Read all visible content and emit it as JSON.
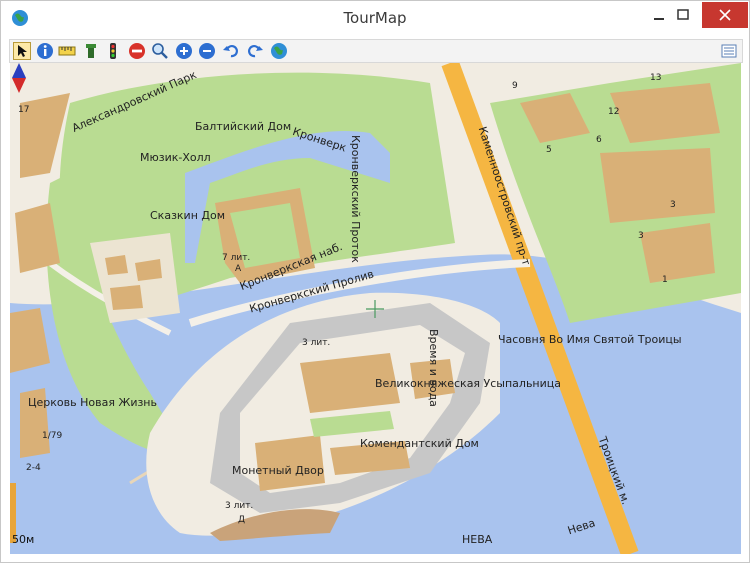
{
  "window": {
    "title": "TourMap"
  },
  "toolbar": {
    "tools": [
      {
        "name": "pointer-icon"
      },
      {
        "name": "info-icon"
      },
      {
        "name": "ruler-icon"
      },
      {
        "name": "tower-icon"
      },
      {
        "name": "traffic-light-icon"
      },
      {
        "name": "no-entry-icon"
      },
      {
        "name": "search-icon"
      },
      {
        "name": "zoom-in-icon"
      },
      {
        "name": "zoom-out-icon"
      },
      {
        "name": "undo-icon"
      },
      {
        "name": "redo-icon"
      },
      {
        "name": "globe-icon"
      }
    ],
    "menu_icon": "list-icon"
  },
  "map": {
    "labels": {
      "aleksandrovsky_park": "Александровский Парк",
      "baltiysky_dom": "Балтийский Дом",
      "kronverk": "Кронверк",
      "musik_hall": "Мюзик-Холл",
      "skazkin_dom": "Сказкин Дом",
      "kronverkskiy_protok": "Кронверкский Проток",
      "kamennoostrovsky": "Каменноостровский пр-т",
      "kronverkskaya_nab": "Кронверкская наб.",
      "kronverkskiy_proliv": "Кронверкский Пролив",
      "chasovnya": "Часовня Во Имя Святой Троицы",
      "vremya": "Время и вода",
      "tserkov": "Церковь Новая Жизнь",
      "velikoknyazheskaya": "Великокняжеская Усыпальница",
      "komendantsky": "Комендантский Дом",
      "monetny_dvor": "Монетный Двор",
      "troitsky": "Троицкий м.",
      "neva_river": "Нева",
      "neva_caps": "НЕВА",
      "lit7": "7 лит.",
      "lit7_a": "А",
      "lit3a": "3 лит.",
      "lit3b": "3 лит.",
      "lit3b_d": "Д",
      "n17": "17",
      "n9": "9",
      "n13": "13",
      "n12": "12",
      "n5": "5",
      "n6": "6",
      "n3a": "3",
      "n3b": "3",
      "n1": "1",
      "n179": "1/79",
      "n24": "2-4"
    },
    "scale": "50м",
    "colors": {
      "water": "#a9c3ee",
      "park": "#b9dc92",
      "building": "#d9b077",
      "fortress": "#c7c7c7",
      "road": "#f4f0e8",
      "main_road": "#f5b642",
      "land": "#f1ece2"
    }
  }
}
